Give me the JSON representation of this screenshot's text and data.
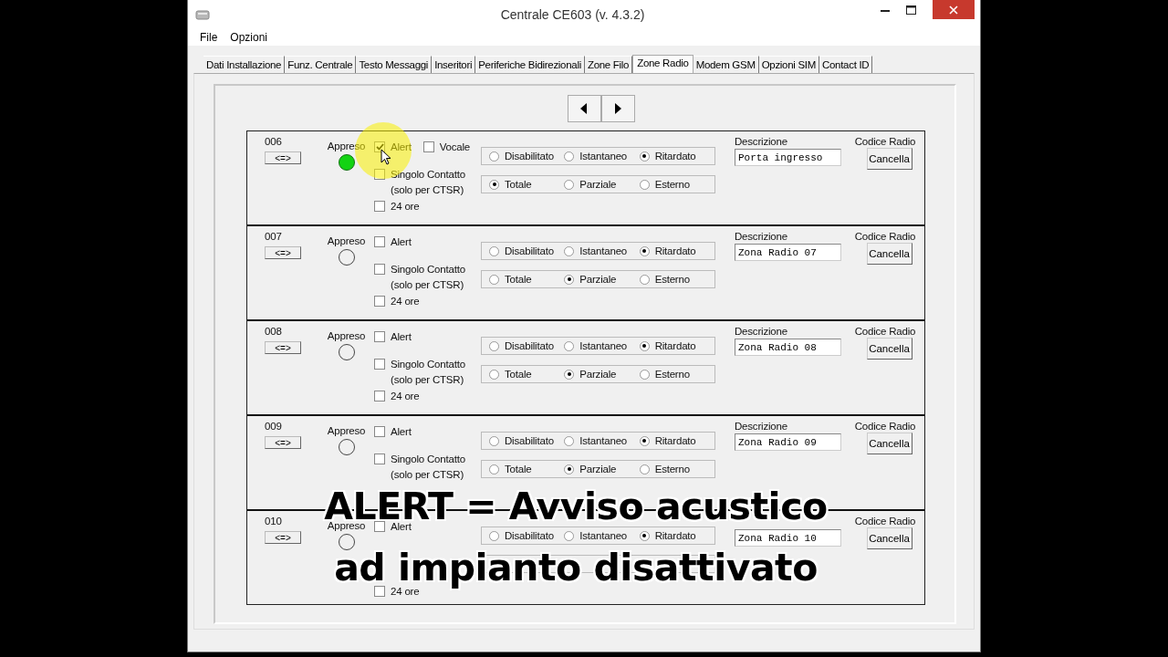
{
  "window": {
    "title": "Centrale CE603 (v. 4.3.2)"
  },
  "menu": [
    "File",
    "Opzioni"
  ],
  "tabs": [
    {
      "label": "Dati Installazione",
      "selected": false
    },
    {
      "label": "Funz. Centrale",
      "selected": false
    },
    {
      "label": "Testo Messaggi",
      "selected": false
    },
    {
      "label": "Inseritori",
      "selected": false
    },
    {
      "label": "Periferiche Bidirezionali",
      "selected": false
    },
    {
      "label": "Zone Filo",
      "selected": false
    },
    {
      "label": "Zone Radio",
      "selected": true
    },
    {
      "label": "Modem GSM",
      "selected": false
    },
    {
      "label": "Opzioni SIM",
      "selected": false
    },
    {
      "label": "Contact ID",
      "selected": false
    }
  ],
  "zones": [
    {
      "number": "006",
      "swap_button": "<=>",
      "appreso_label": "Appreso",
      "appreso": true,
      "alert": {
        "label": "Alert",
        "checked": true
      },
      "vocale": {
        "label": "Vocale",
        "checked": false
      },
      "singolo": {
        "label": "Singolo Contatto",
        "note": "(solo per CTSR)",
        "checked": false
      },
      "h24": {
        "label": "24 ore",
        "checked": false
      },
      "mode": [
        {
          "label": "Disabilitato",
          "selected": false
        },
        {
          "label": "Istantaneo",
          "selected": false
        },
        {
          "label": "Ritardato",
          "selected": true
        }
      ],
      "area": [
        {
          "label": "Totale",
          "selected": true
        },
        {
          "label": "Parziale",
          "selected": false
        },
        {
          "label": "Esterno",
          "selected": false
        }
      ],
      "description_label": "Descrizione",
      "description": "Porta ingresso",
      "code_label": "Codice Radio",
      "cancel_button": "Cancella"
    },
    {
      "number": "007",
      "swap_button": "<=>",
      "appreso_label": "Appreso",
      "appreso": false,
      "alert": {
        "label": "Alert",
        "checked": false
      },
      "singolo": {
        "label": "Singolo Contatto",
        "note": "(solo per CTSR)",
        "checked": false
      },
      "h24": {
        "label": "24 ore",
        "checked": false
      },
      "mode": [
        {
          "label": "Disabilitato",
          "selected": false
        },
        {
          "label": "Istantaneo",
          "selected": false
        },
        {
          "label": "Ritardato",
          "selected": true
        }
      ],
      "area": [
        {
          "label": "Totale",
          "selected": false
        },
        {
          "label": "Parziale",
          "selected": true
        },
        {
          "label": "Esterno",
          "selected": false
        }
      ],
      "description_label": "Descrizione",
      "description": "Zona Radio 07",
      "code_label": "Codice Radio",
      "cancel_button": "Cancella"
    },
    {
      "number": "008",
      "swap_button": "<=>",
      "appreso_label": "Appreso",
      "appreso": false,
      "alert": {
        "label": "Alert",
        "checked": false
      },
      "singolo": {
        "label": "Singolo Contatto",
        "note": "(solo per CTSR)",
        "checked": false
      },
      "h24": {
        "label": "24 ore",
        "checked": false
      },
      "mode": [
        {
          "label": "Disabilitato",
          "selected": false
        },
        {
          "label": "Istantaneo",
          "selected": false
        },
        {
          "label": "Ritardato",
          "selected": true
        }
      ],
      "area": [
        {
          "label": "Totale",
          "selected": false
        },
        {
          "label": "Parziale",
          "selected": true
        },
        {
          "label": "Esterno",
          "selected": false
        }
      ],
      "description_label": "Descrizione",
      "description": "Zona Radio 08",
      "code_label": "Codice Radio",
      "cancel_button": "Cancella"
    },
    {
      "number": "009",
      "swap_button": "<=>",
      "appreso_label": "Appreso",
      "appreso": false,
      "alert": {
        "label": "Alert",
        "checked": false
      },
      "singolo": {
        "label": "Singolo Contatto",
        "note": "(solo per CTSR)",
        "checked": false
      },
      "mode": [
        {
          "label": "Disabilitato",
          "selected": false
        },
        {
          "label": "Istantaneo",
          "selected": false
        },
        {
          "label": "Ritardato",
          "selected": true
        }
      ],
      "area": [
        {
          "label": "Totale",
          "selected": false
        },
        {
          "label": "Parziale",
          "selected": true
        },
        {
          "label": "Esterno",
          "selected": false
        }
      ],
      "description_label": "Descrizione",
      "description": "Zona Radio 09",
      "code_label": "Codice Radio",
      "cancel_button": "Cancella"
    },
    {
      "number": "010",
      "swap_button": "<=>",
      "appreso_label": "Appreso",
      "appreso": false,
      "alert": {
        "label": "Alert",
        "checked": false
      },
      "h24": {
        "label": "24 ore",
        "checked": false
      },
      "mode": [
        {
          "label": "Disabilitato",
          "selected": false
        },
        {
          "label": "Istantaneo",
          "selected": false
        },
        {
          "label": "Ritardato",
          "selected": true
        }
      ],
      "description": "Zona Radio 10",
      "code_label": "Codice Radio",
      "cancel_button": "Cancella"
    }
  ],
  "caption": [
    "ALERT = Avviso acustico",
    "ad impianto disattivato"
  ]
}
